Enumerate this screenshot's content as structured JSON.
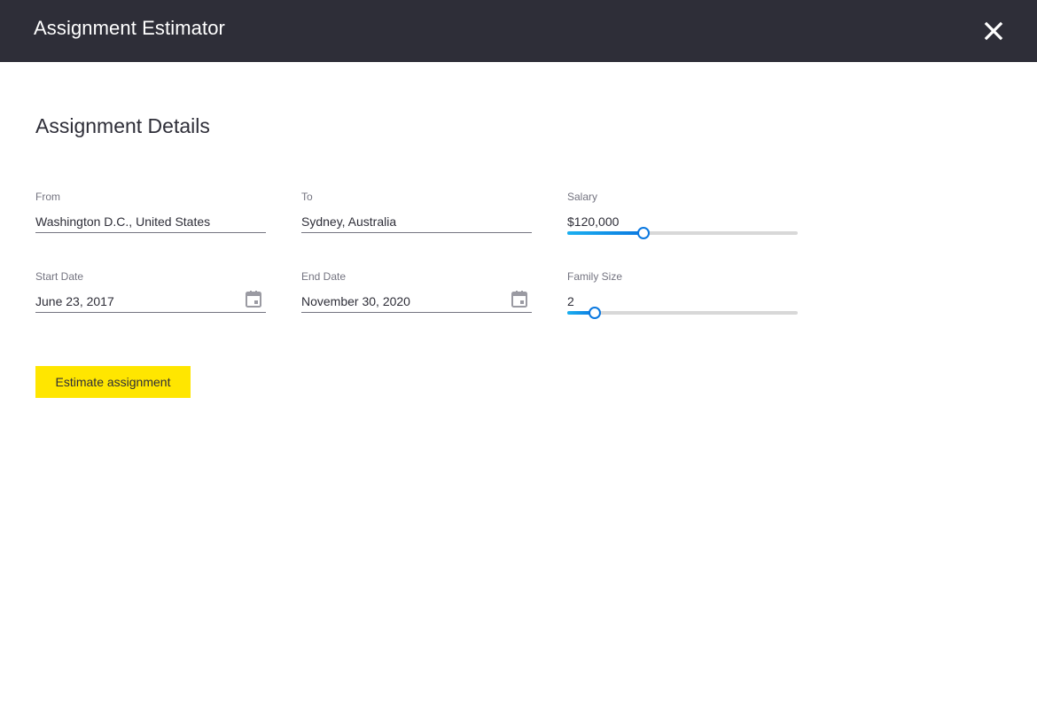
{
  "header": {
    "title": "Assignment Estimator",
    "close_icon": "close-icon"
  },
  "section": {
    "title": "Assignment Details"
  },
  "fields": {
    "from": {
      "label": "From",
      "value": "Washington D.C., United States"
    },
    "to": {
      "label": "To",
      "value": "Sydney, Australia"
    },
    "salary": {
      "label": "Salary",
      "value": "$120,000",
      "slider_fraction": 0.33
    },
    "start_date": {
      "label": "Start Date",
      "value": "June 23, 2017",
      "icon": "calendar-icon"
    },
    "end_date": {
      "label": "End Date",
      "value": "November 30, 2020",
      "icon": "calendar-icon"
    },
    "family_size": {
      "label": "Family Size",
      "value": "2",
      "slider_fraction": 0.12
    }
  },
  "actions": {
    "estimate_label": "Estimate assignment"
  },
  "colors": {
    "header_bg": "#2e2e38",
    "accent_yellow": "#ffe600",
    "slider_blue": "#0a78e0"
  }
}
